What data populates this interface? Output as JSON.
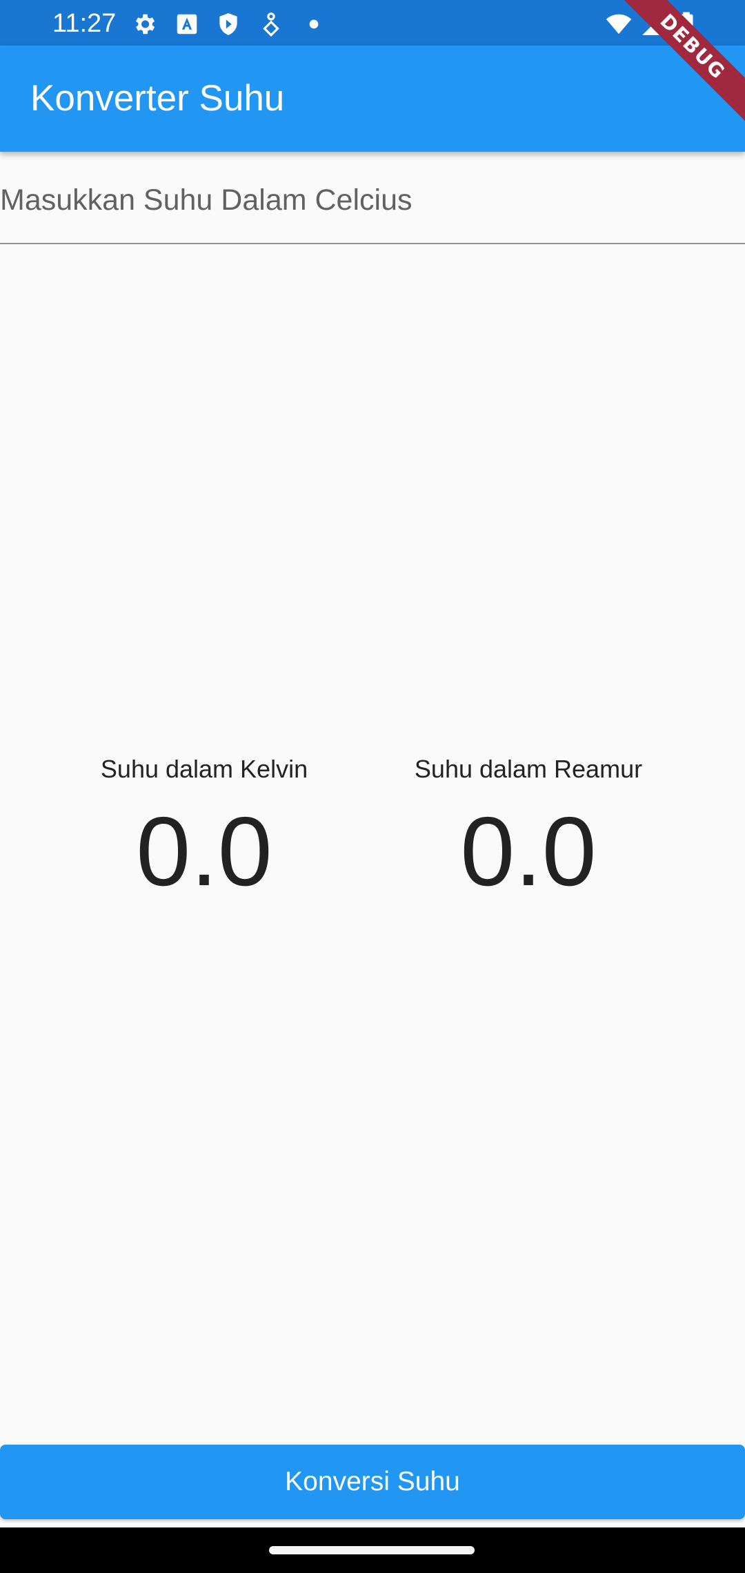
{
  "status_bar": {
    "time": "11:27",
    "icons": [
      "settings-icon",
      "text-a-icon",
      "shield-icon",
      "diamond-pin-icon",
      "dot-icon",
      "wifi-icon",
      "signal-icon",
      "battery-icon"
    ]
  },
  "debug_banner": {
    "label": "DEBUG"
  },
  "app_bar": {
    "title": "Konverter Suhu"
  },
  "input": {
    "placeholder": "Masukkan Suhu Dalam Celcius",
    "value": ""
  },
  "results": {
    "kelvin": {
      "label": "Suhu dalam Kelvin",
      "value": "0.0"
    },
    "reamur": {
      "label": "Suhu dalam Reamur",
      "value": "0.0"
    }
  },
  "button": {
    "label": "Konversi Suhu"
  },
  "colors": {
    "status_bar": "#1976d2",
    "app_bar": "#2196f3",
    "button": "#2196f3",
    "background": "#fafafa",
    "debug_ribbon": "#a0283f"
  }
}
